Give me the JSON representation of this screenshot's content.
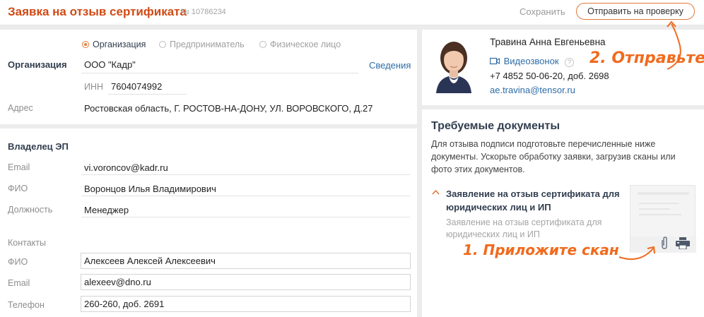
{
  "header": {
    "title": "Заявка на отзыв сертификата",
    "doc_number": "№ 10786234",
    "save_label": "Сохранить",
    "send_label": "Отправить на проверку"
  },
  "org": {
    "radio_options": [
      "Организация",
      "Предприниматель",
      "Физическое лицо"
    ],
    "selected_option": "Организация",
    "org_label": "Организация",
    "org_value": "ООО \"Кадр\"",
    "info_link": "Сведения",
    "inn_label": "ИНН",
    "inn_value": "7604074992",
    "address_label": "Адрес",
    "address_value": "Ростовская область, Г. РОСТОВ-НА-ДОНУ, УЛ. ВОРОВСКОГО, Д.27"
  },
  "owner": {
    "section_title": "Владелец ЭП",
    "email_label": "Email",
    "email_value": "vi.voroncov@kadr.ru",
    "fio_label": "ФИО",
    "fio_value": "Воронцов Илья Владимирович",
    "position_label": "Должность",
    "position_value": "Менеджер",
    "contacts_title": "Контакты",
    "contact_fio_label": "ФИО",
    "contact_fio_value": "Алексеев Алексей Алексеевич",
    "contact_email_label": "Email",
    "contact_email_value": "alexeev@dno.ru",
    "contact_phone_label": "Телефон",
    "contact_phone_value": "260-260, доб. 2691"
  },
  "manager": {
    "name": "Травина Анна Евгеньевна",
    "video_call": "Видеозвонок",
    "phone": "+7 4852 50-06-20, доб. 2698",
    "email": "ae.travina@tensor.ru"
  },
  "docs": {
    "title": "Требуемые документы",
    "description_1": "Для отзыва подписи подготовьте перечисленные ниже",
    "description_2": "документы. Ускорьте обработку заявки, загрузив сканы или",
    "description_3": "фото этих документов.",
    "item_title_1": "Заявление на отзыв сертификата для",
    "item_title_2": "юридических лиц и ИП",
    "item_desc_1": "Заявление на отзыв сертификата для",
    "item_desc_2": "юридических лиц и ИП"
  },
  "annotations": {
    "step1": "1. Приложите скан",
    "step2": "2. Отправьте"
  },
  "colors": {
    "accent": "#d04a14",
    "annotation": "#f06a1d",
    "link": "#2e6ca8"
  }
}
